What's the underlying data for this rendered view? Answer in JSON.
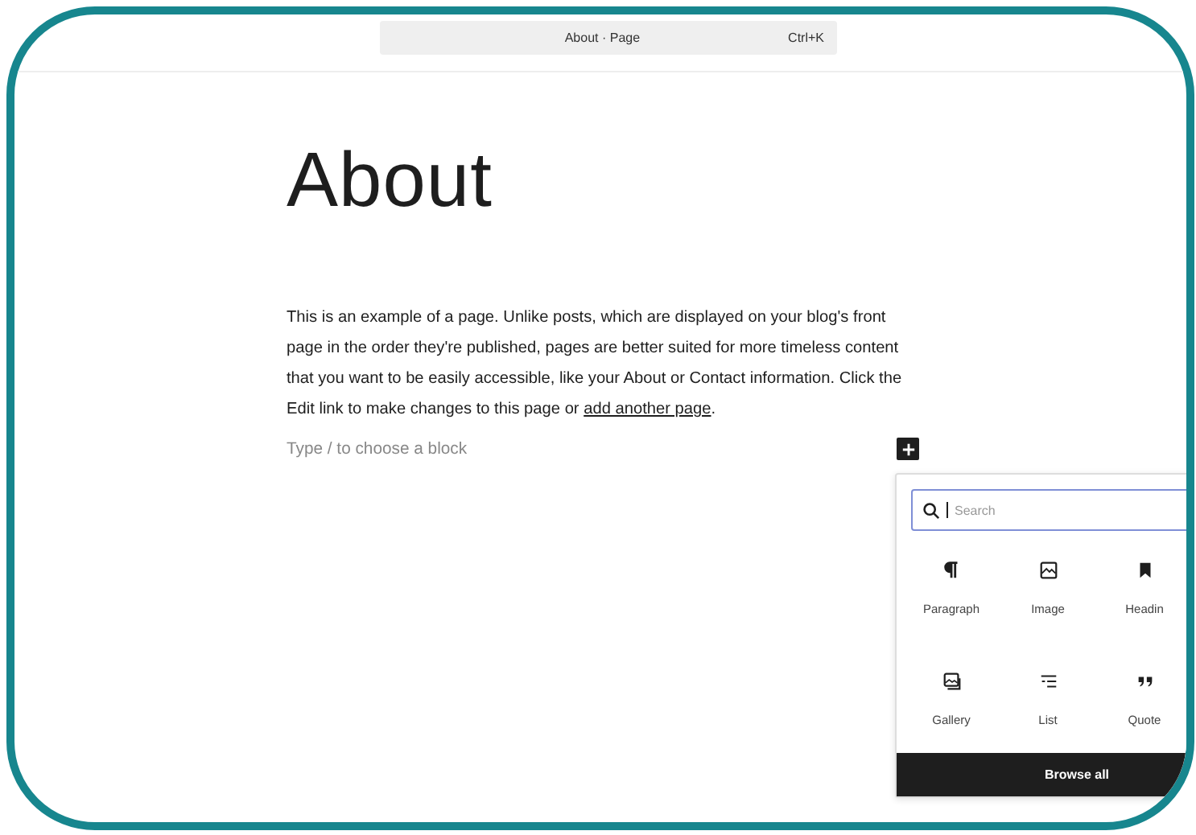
{
  "command_bar": {
    "title": "About · Page",
    "shortcut": "Ctrl+K"
  },
  "page_title": "About",
  "paragraph": {
    "text": "This is an example of a page. Unlike posts, which are displayed on your blog's front page in the order they're published, pages are better suited for more timeless content that you want to be easily accessible, like your About or Contact information. Click the Edit link to make changes to this page or ",
    "link": "add another page",
    "end": "."
  },
  "block_placeholder": "Type / to choose a block",
  "inserter": {
    "search": {
      "placeholder": "Search"
    },
    "blocks": [
      {
        "label": "Paragraph"
      },
      {
        "label": "Image"
      },
      {
        "label": "Headin"
      },
      {
        "label": "Gallery"
      },
      {
        "label": "List"
      },
      {
        "label": "Quote"
      }
    ],
    "browse_all": "Browse all"
  }
}
